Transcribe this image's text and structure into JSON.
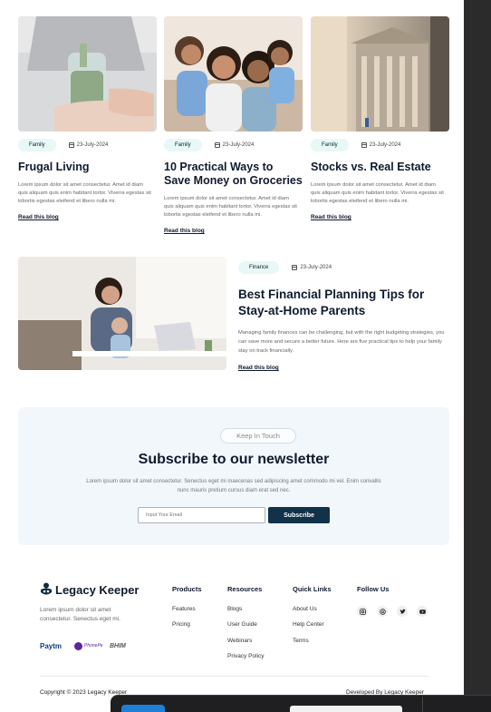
{
  "blogs": [
    {
      "tag": "Family",
      "date": "23-July-2024",
      "title": "Frugal Living",
      "excerpt": "Lorem ipsum dolor sit amet consectetur. Amet id diam quis aliquam quis enim habitant tortor. Viverra egestas sit lobortis egestas eleifend et libero nulla mi.",
      "link": "Read this blog"
    },
    {
      "tag": "Family",
      "date": "23-July-2024",
      "title": "10 Practical Ways to Save Money on Groceries",
      "excerpt": "Lorem ipsum dolor sit amet consectetur. Amet id diam quis aliquam quis enim habitant tortor. Viverra egestas sit lobortis egestas eleifend et libero nulla mi.",
      "link": "Read this blog"
    },
    {
      "tag": "Family",
      "date": "23-July-2024",
      "title": "Stocks vs. Real Estate",
      "excerpt": "Lorem ipsum dolor sit amet consectetur. Amet id diam quis aliquam quis enim habitant tortor. Viverra egestas sit lobortis egestas eleifend et libero nulla mi.",
      "link": "Read this blog"
    }
  ],
  "featured": {
    "tag": "Finance",
    "date": "23-July-2024",
    "title": "Best Financial Planning Tips for Stay-at-Home Parents",
    "excerpt": "Managing family finances can be challenging, but with the right budgeting strategies, you can save more and secure a better future. Here are five practical tips to help your family stay on track financially.",
    "link": "Read this blog"
  },
  "newsletter": {
    "pill": "Keep In Touch",
    "title": "Subscribe to our newsletter",
    "text": "Lorem ipsum dolor sit amet consectetur. Senectus eget mi maecenas sed adipiscing amet commodo mi vel. Enim convallis nunc mauris pretium cursus diam erat sed nec.",
    "placeholder": "Input Your Email",
    "button": "Subscribe"
  },
  "footer": {
    "brand": "Legacy Keeper",
    "description": "Lorem ipsum dolor sit amet consectetur. Senectus eget mi.",
    "payments": [
      "Paytm",
      "PhonePe",
      "BHIM"
    ],
    "columns": [
      {
        "title": "Products",
        "items": [
          "Features",
          "Pricing"
        ]
      },
      {
        "title": "Resources",
        "items": [
          "Blogs",
          "User Guide",
          "Webinars",
          "Privacy Policy"
        ]
      },
      {
        "title": "Quick Links",
        "items": [
          "About Us",
          "Help Center",
          "Terms"
        ]
      }
    ],
    "follow_title": "Follow Us",
    "social": [
      "instagram-icon",
      "threads-icon",
      "twitter-icon",
      "youtube-icon"
    ],
    "copyright": "Copyright © 2023 Legacy Keeper",
    "developed": "Developed By Legacy Keeper"
  }
}
